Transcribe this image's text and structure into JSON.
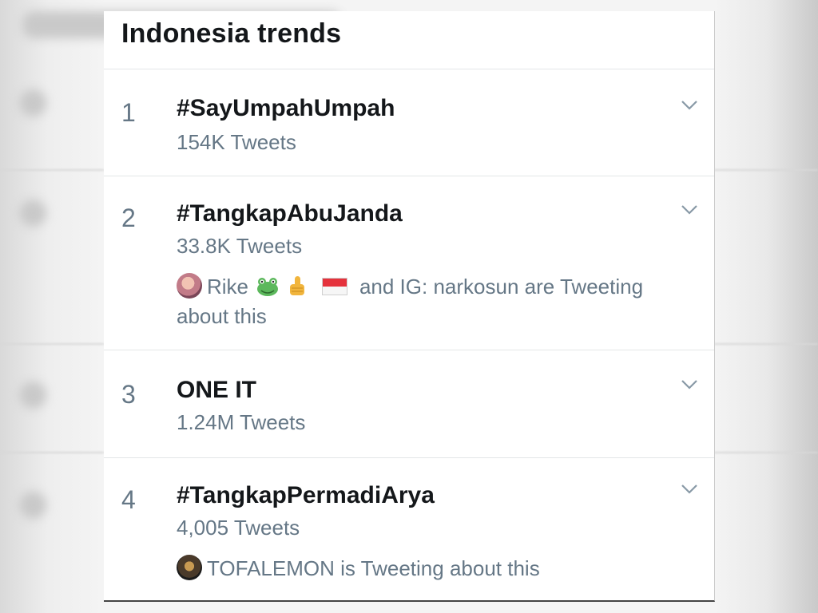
{
  "header": {
    "title": "Indonesia trends"
  },
  "trends": [
    {
      "rank": "1",
      "name": "#SayUmpahUmpah",
      "count": "154K Tweets"
    },
    {
      "rank": "2",
      "name": "#TangkapAbuJanda",
      "count": "33.8K Tweets",
      "context": {
        "user": "Rike",
        "text_line1": "and IG: narkosun are Tweeting",
        "text_line2": "about this"
      }
    },
    {
      "rank": "3",
      "name": "ONE IT",
      "count": "1.24M Tweets"
    },
    {
      "rank": "4",
      "name": "#TangkapPermadiArya",
      "count": "4,005 Tweets",
      "context": {
        "user": "TOFALEMON",
        "text": "is Tweeting about this"
      }
    }
  ],
  "colors": {
    "title": "#14171a",
    "secondary": "#657786",
    "divider": "#e3e6e8"
  },
  "icons": {
    "menu": "chevron-down-icon"
  }
}
